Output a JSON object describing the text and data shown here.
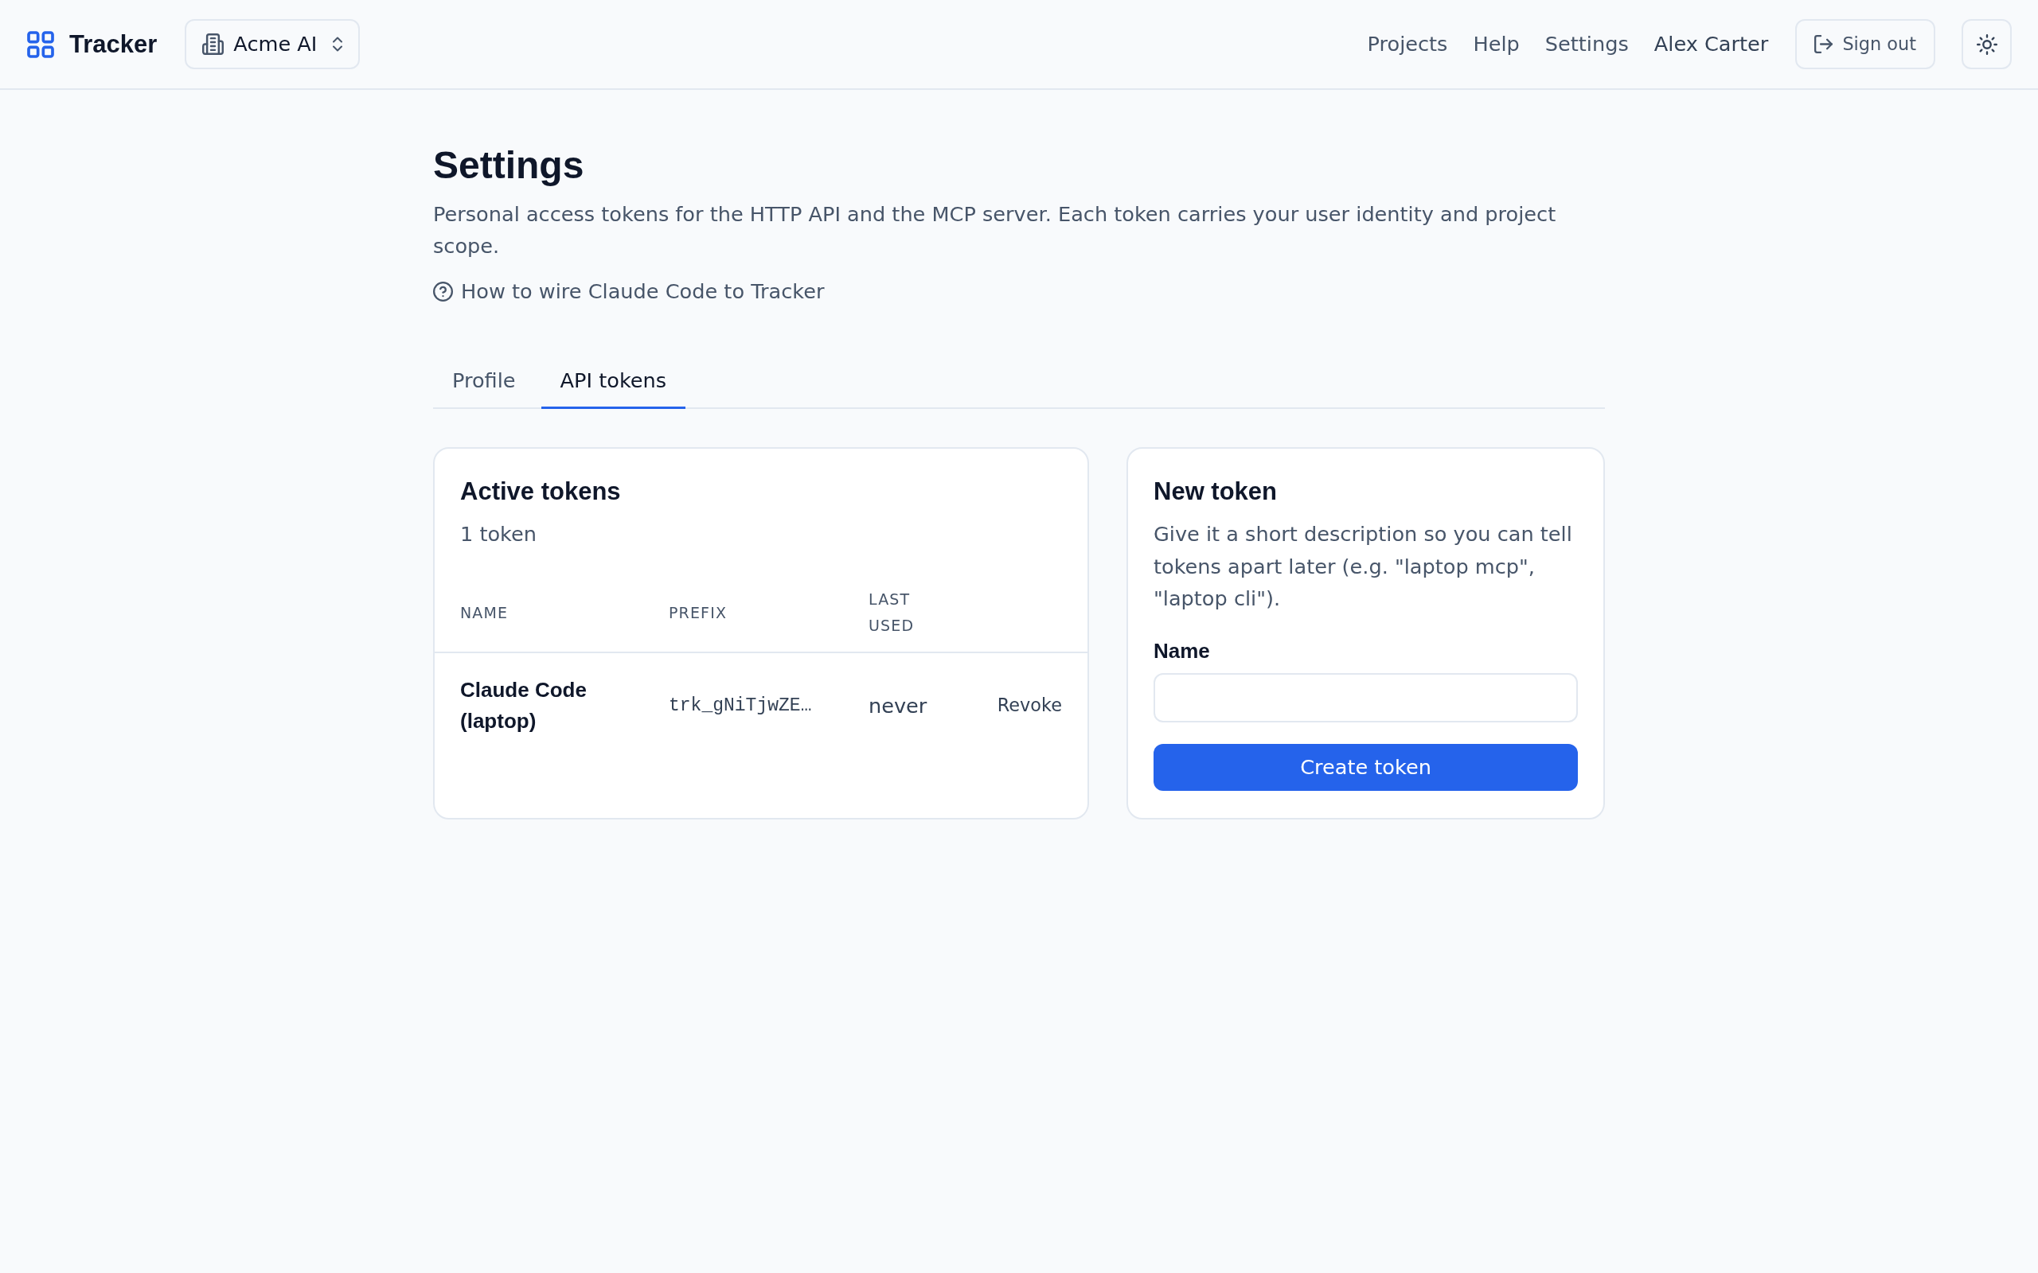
{
  "header": {
    "app_name": "Tracker",
    "organization": "Acme AI",
    "nav_links": [
      "Projects",
      "Help",
      "Settings"
    ],
    "user_name": "Alex Carter",
    "sign_out": "Sign out"
  },
  "settings": {
    "title": "Settings",
    "description": "Personal access tokens for the HTTP API and the MCP server. Each token carries your user identity and project scope.",
    "help_link": "How to wire Claude Code to Tracker",
    "tabs": [
      {
        "label": "Profile",
        "selected": false
      },
      {
        "label": "API tokens",
        "selected": true
      }
    ]
  },
  "active_tokens": {
    "title": "Active tokens",
    "count": "1 token",
    "columns": [
      "NAME",
      "PREFIX",
      "LAST USED"
    ],
    "rows": [
      {
        "name": "Claude Code (laptop)",
        "prefix": "trk_gNiTjwZE…",
        "last_used": "never",
        "action": "Revoke"
      }
    ]
  },
  "new_token": {
    "title": "New token",
    "description": "Give it a short description so you can tell tokens apart later (e.g. \"laptop mcp\", \"laptop cli\").",
    "field_label": "Name",
    "submit_button": "Create token"
  }
}
